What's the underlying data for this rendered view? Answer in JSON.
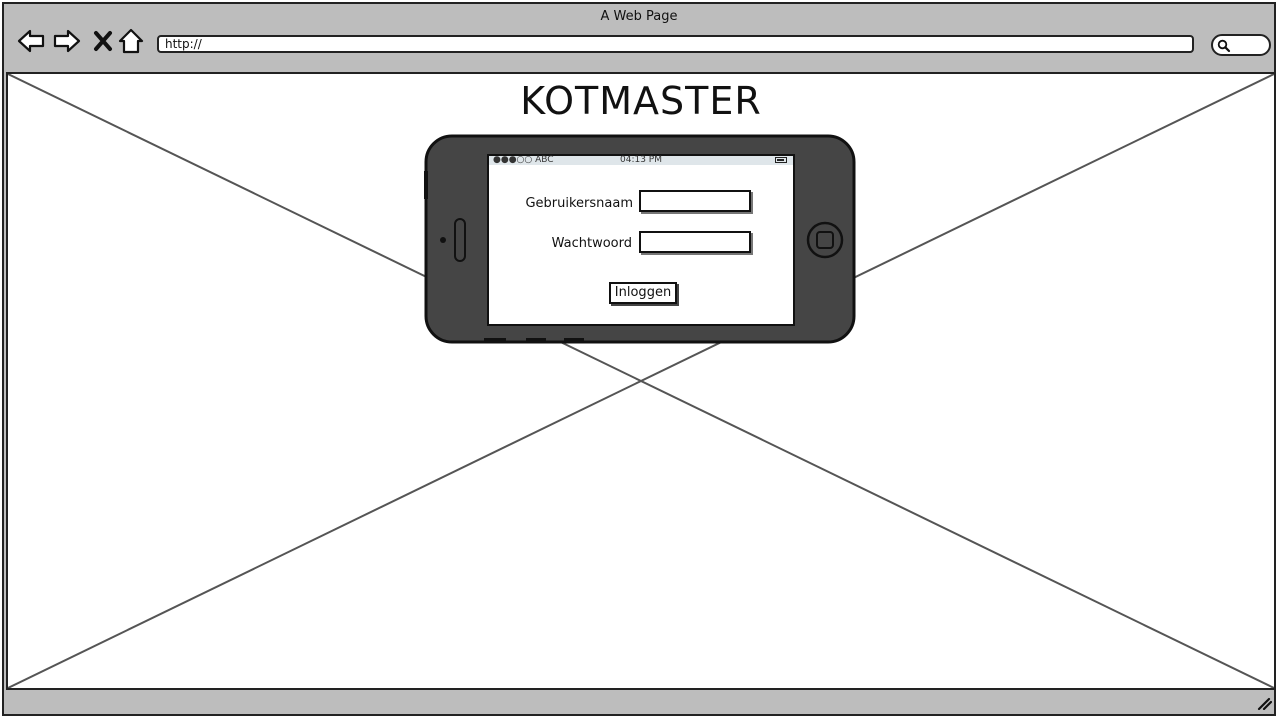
{
  "window": {
    "title": "A Web Page"
  },
  "toolbar": {
    "back_icon": "arrow-left-icon",
    "forward_icon": "arrow-right-icon",
    "stop_icon": "close-icon",
    "home_icon": "home-icon",
    "url": "http://",
    "search_icon": "search-icon"
  },
  "page": {
    "brand": "KOTMASTER"
  },
  "phone": {
    "status": {
      "carrier": "●●●○○ ABC",
      "time": "04:13 PM"
    },
    "form": {
      "username_label": "Gebruikersnaam",
      "username_value": "",
      "password_label": "Wachtwoord",
      "password_value": "",
      "login_label": "Inloggen"
    }
  },
  "colors": {
    "chrome": "#bdbdbd",
    "phone_body": "#444444",
    "status_bar": "#dfe6ea"
  }
}
